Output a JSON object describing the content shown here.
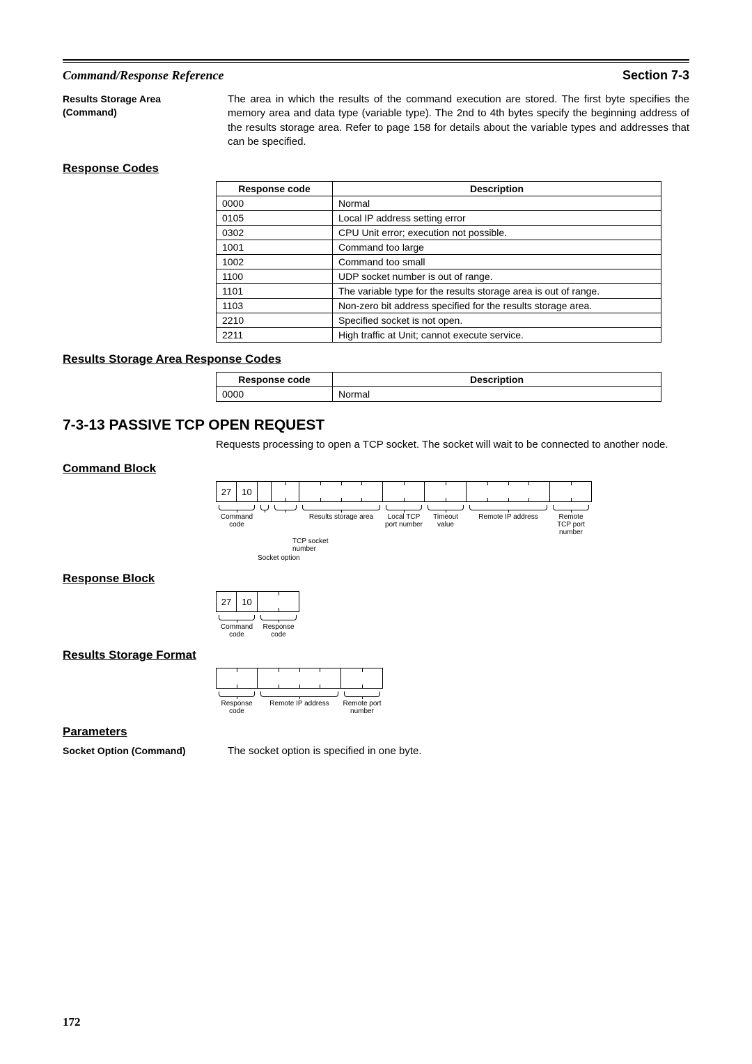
{
  "header": {
    "left": "Command/Response Reference",
    "right": "Section 7-3"
  },
  "rsa": {
    "label": "Results Storage Area (Command)",
    "text": "The area in which the results of the command execution are stored. The first byte specifies the memory area and data type (variable type). The 2nd to 4th bytes specify the beginning address of the results storage area. Refer to page 158 for details about the variable types and addresses that can be specified."
  },
  "response_codes": {
    "heading": "Response Codes",
    "th_code": "Response code",
    "th_desc": "Description",
    "rows": [
      {
        "c": "0000",
        "d": "Normal"
      },
      {
        "c": "0105",
        "d": "Local IP address setting error"
      },
      {
        "c": "0302",
        "d": "CPU Unit error; execution not possible."
      },
      {
        "c": "1001",
        "d": "Command too large"
      },
      {
        "c": "1002",
        "d": "Command too small"
      },
      {
        "c": "1100",
        "d": "UDP socket number is out of range."
      },
      {
        "c": "1101",
        "d": "The variable type for the results storage area is out of range."
      },
      {
        "c": "1103",
        "d": "Non-zero bit address specified for the results storage area."
      },
      {
        "c": "2210",
        "d": "Specified socket is not open."
      },
      {
        "c": "2211",
        "d": "High traffic at Unit; cannot execute service."
      }
    ]
  },
  "rsa_codes": {
    "heading": "Results Storage Area Response Codes",
    "rows": [
      {
        "c": "0000",
        "d": "Normal"
      }
    ]
  },
  "cmd": {
    "num_title": "7-3-13  PASSIVE TCP OPEN REQUEST",
    "intro": "Requests processing to open a TCP socket. The socket will wait to be connected to another node."
  },
  "command_block": {
    "heading": "Command Block",
    "b1": "27",
    "b2": "10",
    "labels": {
      "cmd_code": "Command code",
      "socket_option": "Socket option",
      "tcp_socket_number": "TCP socket number",
      "results_storage": "Results storage area",
      "local_tcp_port": "Local TCP port number",
      "timeout": "Timeout value",
      "remote_ip": "Remote IP address",
      "remote_tcp_port": "Remote TCP port number"
    }
  },
  "response_block": {
    "heading": "Response Block",
    "b1": "27",
    "b2": "10",
    "labels": {
      "cmd_code": "Command code",
      "resp_code": "Response code"
    }
  },
  "results_storage_format": {
    "heading": "Results Storage Format",
    "labels": {
      "resp_code": "Response code",
      "remote_ip": "Remote IP address",
      "remote_port": "Remote port number"
    }
  },
  "parameters": {
    "heading": "Parameters",
    "socket_option": {
      "label": "Socket Option (Command)",
      "text": "The socket option is specified in one byte."
    }
  },
  "page_number": "172"
}
